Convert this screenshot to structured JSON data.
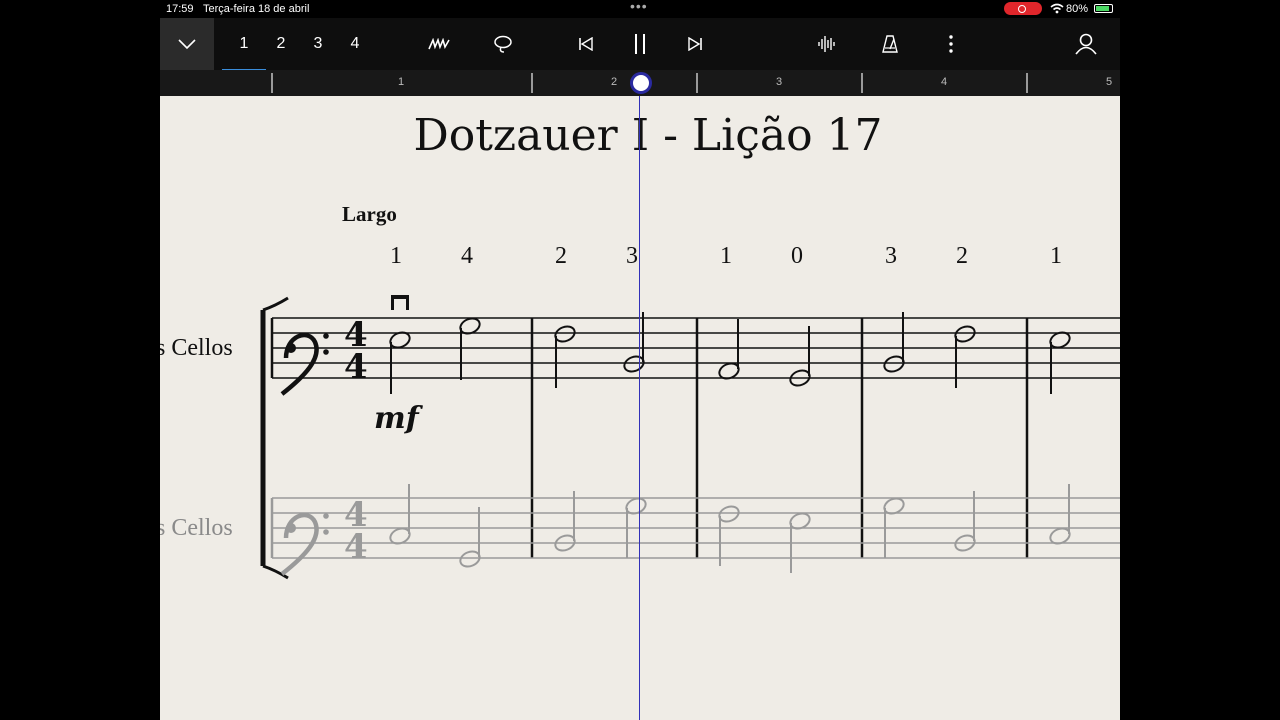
{
  "status_bar": {
    "time": "17:59",
    "date": "Terça-feira 18 de abril",
    "battery": "80%"
  },
  "toolbar": {
    "layers": [
      "1",
      "2",
      "3",
      "4"
    ],
    "active_layer": "1",
    "icons": [
      "chevron-down-icon",
      "pen-icon",
      "lasso-icon",
      "skip-back-icon",
      "pause-icon",
      "skip-forward-icon",
      "waveform-icon",
      "metronome-icon",
      "more-vertical-icon",
      "account-icon"
    ]
  },
  "ruler": {
    "measures": [
      "1",
      "2",
      "3",
      "4",
      "5"
    ]
  },
  "score": {
    "title": "Dotzauer I - Lição 17",
    "tempo": "Largo",
    "fingerings": [
      "1",
      "4",
      "2",
      "3",
      "1",
      "0",
      "3",
      "2",
      "1"
    ],
    "dynamic": "mf",
    "staff1_label": "s Cellos",
    "staff2_label": "s Cellos",
    "time_signature": "4/4"
  },
  "colors": {
    "paper": "#efece6",
    "playhead": "#3131b8",
    "accent": "#3a8ddb",
    "muted_staff": "#9a9a9a"
  }
}
